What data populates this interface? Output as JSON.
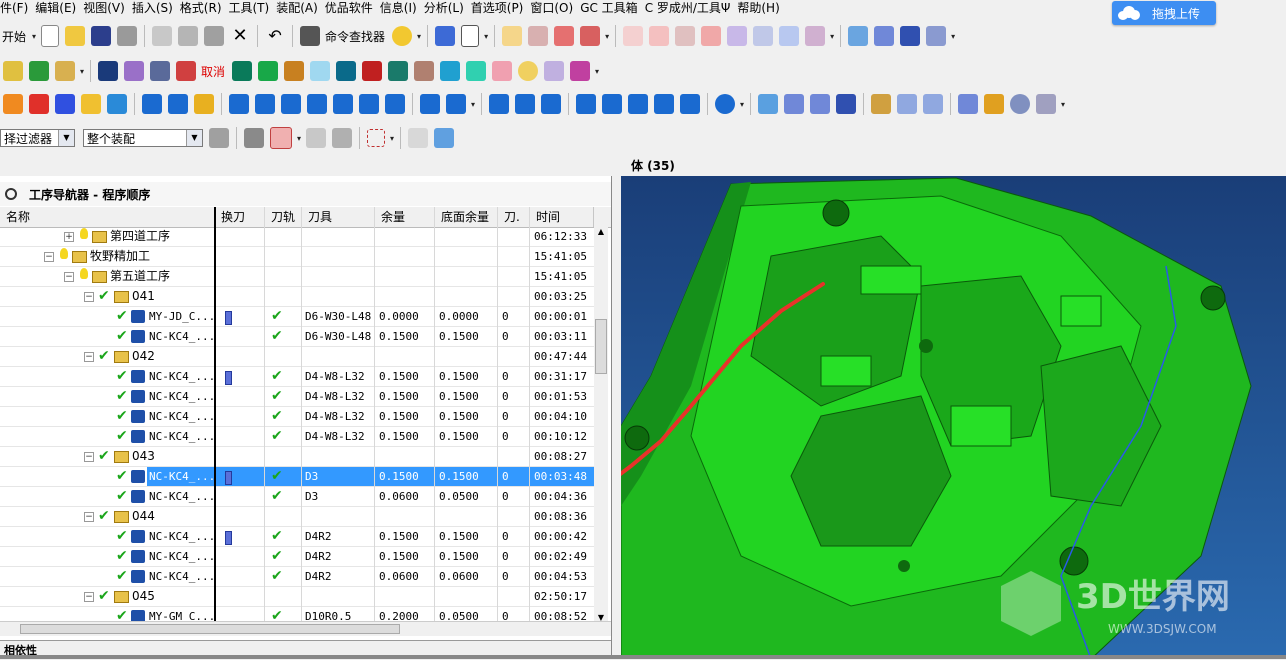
{
  "menu": [
    "件(F)",
    "编辑(E)",
    "视图(V)",
    "插入(S)",
    "格式(R)",
    "工具(T)",
    "装配(A)",
    "优品软件",
    "信息(I)",
    "分析(L)",
    "首选项(P)",
    "窗口(O)",
    "GC 工具箱",
    "C 罗成州/工具Ψ",
    "帮助(H)"
  ],
  "upload_button": "拖拽上传",
  "toolbar": {
    "start_label": "开始",
    "command_finder": "命令查找器",
    "filter_label": "择过滤器",
    "assembly_combo": "整个装配"
  },
  "navigator": {
    "title": "工序导航器 - 程序顺序"
  },
  "viewport": {
    "title": "体 (35)",
    "watermark_brand": "3D世界网",
    "watermark_url": "WWW.3DSJW.COM"
  },
  "columns": [
    "名称",
    "换刀",
    "刀轨",
    "刀具",
    "余量",
    "底面余量",
    "刀.",
    "时间"
  ],
  "rows": [
    {
      "level": 2,
      "type": "group",
      "toggle": "+",
      "name": "第四道工序",
      "time": "06:12:33"
    },
    {
      "level": 1,
      "type": "group",
      "toggle": "-",
      "name": "牧野精加工",
      "time": "15:41:05"
    },
    {
      "level": 2,
      "type": "group",
      "toggle": "-",
      "name": "第五道工序",
      "time": "15:41:05"
    },
    {
      "level": 3,
      "type": "sub",
      "toggle": "-",
      "name": "041",
      "time": "00:03:25"
    },
    {
      "level": 4,
      "type": "op",
      "name": "MY-JD_C...",
      "tc": true,
      "path": true,
      "tool": "D6-W30-L48",
      "stock": "0.0000",
      "floor": "0.0000",
      "n": "0",
      "time": "00:00:01"
    },
    {
      "level": 4,
      "type": "op",
      "name": "NC-KC4_...",
      "tc": false,
      "path": true,
      "tool": "D6-W30-L48",
      "stock": "0.1500",
      "floor": "0.1500",
      "n": "0",
      "time": "00:03:11"
    },
    {
      "level": 3,
      "type": "sub",
      "toggle": "-",
      "name": "042",
      "time": "00:47:44"
    },
    {
      "level": 4,
      "type": "op",
      "name": "NC-KC4_...",
      "tc": true,
      "path": true,
      "tool": "D4-W8-L32",
      "stock": "0.1500",
      "floor": "0.1500",
      "n": "0",
      "time": "00:31:17"
    },
    {
      "level": 4,
      "type": "op",
      "name": "NC-KC4_...",
      "tc": false,
      "path": true,
      "tool": "D4-W8-L32",
      "stock": "0.1500",
      "floor": "0.1500",
      "n": "0",
      "time": "00:01:53"
    },
    {
      "level": 4,
      "type": "op",
      "name": "NC-KC4_...",
      "tc": false,
      "path": true,
      "tool": "D4-W8-L32",
      "stock": "0.1500",
      "floor": "0.1500",
      "n": "0",
      "time": "00:04:10"
    },
    {
      "level": 4,
      "type": "op",
      "name": "NC-KC4_...",
      "tc": false,
      "path": true,
      "tool": "D4-W8-L32",
      "stock": "0.1500",
      "floor": "0.1500",
      "n": "0",
      "time": "00:10:12"
    },
    {
      "level": 3,
      "type": "sub",
      "toggle": "-",
      "name": "043",
      "time": "00:08:27"
    },
    {
      "level": 4,
      "type": "op",
      "sel": true,
      "name": "NC-KC4_...",
      "tc": true,
      "path": true,
      "tool": "D3",
      "stock": "0.1500",
      "floor": "0.1500",
      "n": "0",
      "time": "00:03:48"
    },
    {
      "level": 4,
      "type": "op",
      "name": "NC-KC4_...",
      "tc": false,
      "path": true,
      "tool": "D3",
      "stock": "0.0600",
      "floor": "0.0500",
      "n": "0",
      "time": "00:04:36"
    },
    {
      "level": 3,
      "type": "sub",
      "toggle": "-",
      "name": "044",
      "time": "00:08:36"
    },
    {
      "level": 4,
      "type": "op",
      "name": "NC-KC4_...",
      "tc": true,
      "path": true,
      "tool": "D4R2",
      "stock": "0.1500",
      "floor": "0.1500",
      "n": "0",
      "time": "00:00:42"
    },
    {
      "level": 4,
      "type": "op",
      "name": "NC-KC4_...",
      "tc": false,
      "path": true,
      "tool": "D4R2",
      "stock": "0.1500",
      "floor": "0.1500",
      "n": "0",
      "time": "00:02:49"
    },
    {
      "level": 4,
      "type": "op",
      "name": "NC-KC4_...",
      "tc": false,
      "path": true,
      "tool": "D4R2",
      "stock": "0.0600",
      "floor": "0.0600",
      "n": "0",
      "time": "00:04:53"
    },
    {
      "level": 3,
      "type": "sub",
      "toggle": "-",
      "name": "045",
      "time": "02:50:17"
    },
    {
      "level": 4,
      "type": "op",
      "name": "MY-GM_C...",
      "tc": false,
      "path": true,
      "tool": "D10R0.5",
      "stock": "0.2000",
      "floor": "0.0500",
      "n": "0",
      "time": "00:08:52"
    }
  ],
  "bottom_panel": {
    "title": "相依性"
  },
  "colors": {
    "selection": "#3399ff",
    "model_green": "#22d422",
    "viewport_bg": "#1d4a8a",
    "check_green": "#1aa51a",
    "annotation_red": "#e8322a"
  }
}
